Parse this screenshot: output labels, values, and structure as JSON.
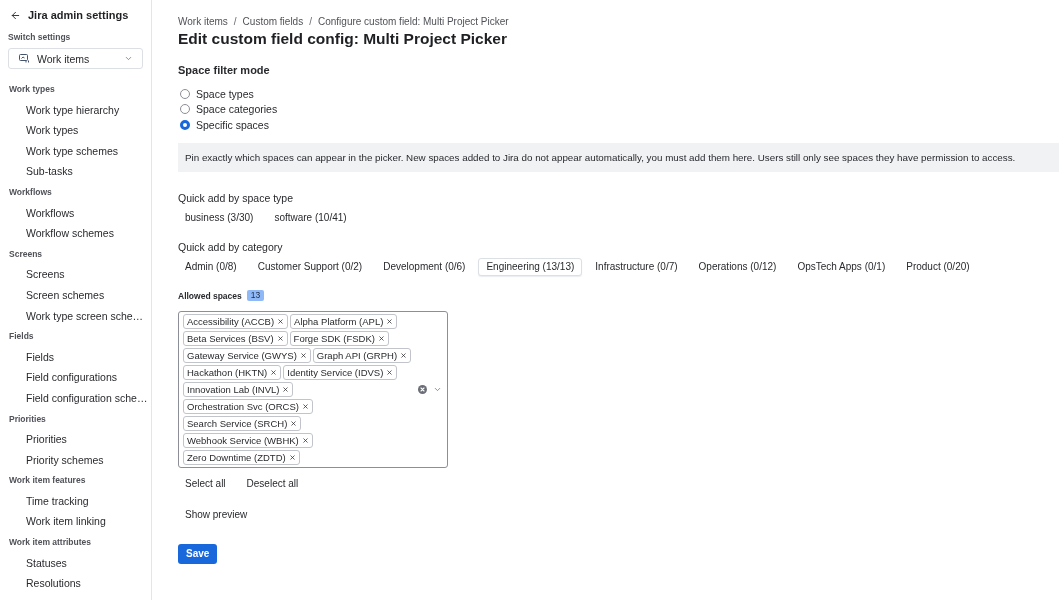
{
  "sidebar": {
    "title": "Jira admin settings",
    "switch_label": "Switch settings",
    "switcher": {
      "value": "Work items"
    },
    "groups": [
      {
        "heading": "Work types",
        "items": [
          {
            "label": "Work type hierarchy",
            "selected": false
          },
          {
            "label": "Work types",
            "selected": false
          },
          {
            "label": "Work type schemes",
            "selected": false
          },
          {
            "label": "Sub-tasks",
            "selected": false
          }
        ]
      },
      {
        "heading": "Workflows",
        "items": [
          {
            "label": "Workflows",
            "selected": false
          },
          {
            "label": "Workflow schemes",
            "selected": false
          }
        ]
      },
      {
        "heading": "Screens",
        "items": [
          {
            "label": "Screens",
            "selected": false
          },
          {
            "label": "Screen schemes",
            "selected": false
          },
          {
            "label": "Work type screen sche…",
            "selected": false
          }
        ]
      },
      {
        "heading": "Fields",
        "items": [
          {
            "label": "Fields",
            "selected": false
          },
          {
            "label": "Field configurations",
            "selected": false
          },
          {
            "label": "Field configuration sche…",
            "selected": false
          }
        ]
      },
      {
        "heading": "Priorities",
        "items": [
          {
            "label": "Priorities",
            "selected": false
          },
          {
            "label": "Priority schemes",
            "selected": false
          }
        ]
      },
      {
        "heading": "Work item features",
        "items": [
          {
            "label": "Time tracking",
            "selected": false
          },
          {
            "label": "Work item linking",
            "selected": false
          }
        ]
      },
      {
        "heading": "Work item attributes",
        "items": [
          {
            "label": "Statuses",
            "selected": false
          },
          {
            "label": "Resolutions",
            "selected": false
          }
        ]
      }
    ]
  },
  "breadcrumbs": [
    "Work items",
    "Custom fields",
    "Configure custom field: Multi Project Picker"
  ],
  "breadcrumb_separator": "/",
  "title": "Edit custom field config: Multi Project Picker",
  "filter_mode": {
    "heading": "Space filter mode",
    "options": [
      {
        "label": "Space types",
        "selected": false
      },
      {
        "label": "Space categories",
        "selected": false
      },
      {
        "label": "Specific spaces",
        "selected": true
      }
    ]
  },
  "notice": "Pin exactly which spaces can appear in the picker. New spaces added to Jira do not appear automatically, you must add them here. Users still only see spaces they have permission to access.",
  "quick_add_type": {
    "label": "Quick add by space type",
    "options": [
      {
        "label": "business (3/30)",
        "selected": false
      },
      {
        "label": "software (10/41)",
        "selected": false
      }
    ]
  },
  "quick_add_category": {
    "label": "Quick add by category",
    "options": [
      {
        "label": "Admin (0/8)",
        "selected": false
      },
      {
        "label": "Customer Support (0/2)",
        "selected": false
      },
      {
        "label": "Development (0/6)",
        "selected": false
      },
      {
        "label": "Engineering (13/13)",
        "selected": true
      },
      {
        "label": "Infrastructure (0/7)",
        "selected": false
      },
      {
        "label": "Operations (0/12)",
        "selected": false
      },
      {
        "label": "OpsTech Apps (0/1)",
        "selected": false
      },
      {
        "label": "Product (0/20)",
        "selected": false
      }
    ]
  },
  "allowed_spaces": {
    "label": "Allowed spaces",
    "count": "13",
    "tags": [
      "Accessibility (ACCB)",
      "Alpha Platform (APL)",
      "Beta Services (BSV)",
      "Forge SDK (FSDK)",
      "Gateway Service (GWYS)",
      "Graph API (GRPH)",
      "Hackathon (HKTN)",
      "Identity Service (IDVS)",
      "Innovation Lab (INVL)",
      "Orchestration Svc (ORCS)",
      "Search Service (SRCH)",
      "Webhook Service (WBHK)",
      "Zero Downtime (ZDTD)"
    ]
  },
  "bulk_actions": [
    "Select all",
    "Deselect all"
  ],
  "preview_button": "Show preview",
  "save_button": "Save"
}
